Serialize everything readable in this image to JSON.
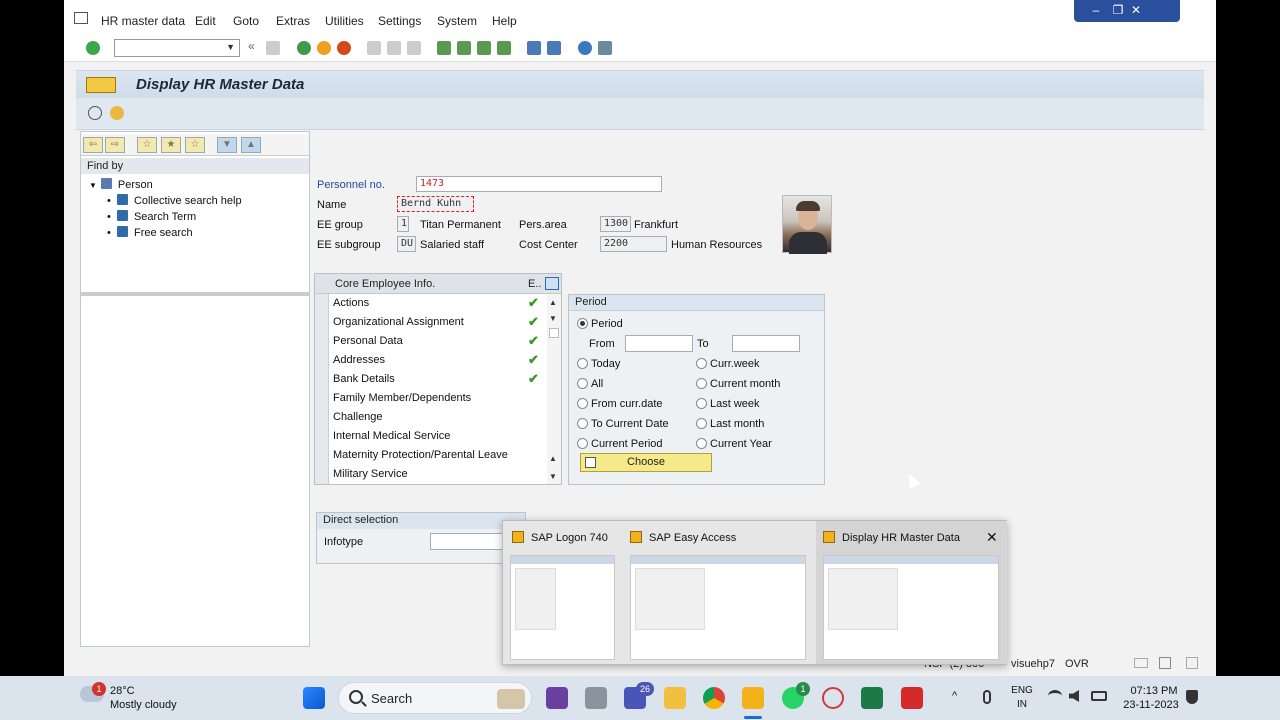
{
  "menu": {
    "items": [
      "HR master data",
      "Edit",
      "Goto",
      "Extras",
      "Utilities",
      "Settings",
      "System",
      "Help"
    ]
  },
  "window_controls": [
    "–",
    "❐",
    "✕"
  ],
  "title": "Display HR Master Data",
  "nav": {
    "find_by": "Find by",
    "root": "Person",
    "children": [
      "Collective search help",
      "Search Term",
      "Free search"
    ]
  },
  "header": {
    "personnel_no_label": "Personnel no.",
    "personnel_no": "1473",
    "name_label": "Name",
    "name": "Bernd Kuhn",
    "ee_group_label": "EE group",
    "ee_group_code": "1",
    "ee_group_text": "Titan Permanent",
    "ee_subgroup_label": "EE subgroup",
    "ee_subgroup_code": "DU",
    "ee_subgroup_text": "Salaried staff",
    "pers_area_label": "Pers.area",
    "pers_area_code": "1300",
    "pers_area_text": "Frankfurt",
    "cost_center_label": "Cost Center",
    "cost_center_code": "2200",
    "cost_center_text": "Human Resources"
  },
  "infotypes": {
    "header": "Core Employee Info.",
    "col_e": "E..",
    "rows": [
      {
        "label": "Actions",
        "exists": true
      },
      {
        "label": "Organizational Assignment",
        "exists": true
      },
      {
        "label": "Personal Data",
        "exists": true
      },
      {
        "label": "Addresses",
        "exists": true
      },
      {
        "label": "Bank Details",
        "exists": true
      },
      {
        "label": "Family Member/Dependents",
        "exists": false
      },
      {
        "label": "Challenge",
        "exists": false
      },
      {
        "label": "Internal Medical Service",
        "exists": false
      },
      {
        "label": "Maternity Protection/Parental Leave",
        "exists": false
      },
      {
        "label": "Military Service",
        "exists": false
      }
    ]
  },
  "period": {
    "title": "Period",
    "selected": "Period",
    "from_label": "From",
    "to_label": "To",
    "from_value": "",
    "to_value": "",
    "options_left": [
      "Today",
      "All",
      "From curr.date",
      "To Current Date",
      "Current Period"
    ],
    "options_right": [
      "Curr.week",
      "Current month",
      "Last week",
      "Last month",
      "Current Year"
    ],
    "choose_label": "Choose"
  },
  "direct_selection": {
    "title": "Direct selection",
    "infotype_label": "Infotype",
    "infotype_value": ""
  },
  "status": {
    "system": "NSP (2) 800",
    "server": "visuehp7",
    "mode": "OVR"
  },
  "thumbnails": [
    {
      "title": "SAP Logon 740"
    },
    {
      "title": "SAP Easy Access"
    },
    {
      "title": "Display HR Master Data"
    }
  ],
  "taskbar": {
    "weather_temp": "28°C",
    "weather_desc": "Mostly cloudy",
    "weather_badge": "1",
    "search_label": "Search",
    "teams_badge": "26",
    "whatsapp_badge": "1",
    "lang_line1": "ENG",
    "lang_line2": "IN",
    "time": "07:13 PM",
    "date": "23-11-2023"
  },
  "colors": {
    "accent": "#1f4b9a",
    "check": "#3a9a2a",
    "choose_button": "#f6e98a",
    "title_bar": "#dbe6f0"
  }
}
